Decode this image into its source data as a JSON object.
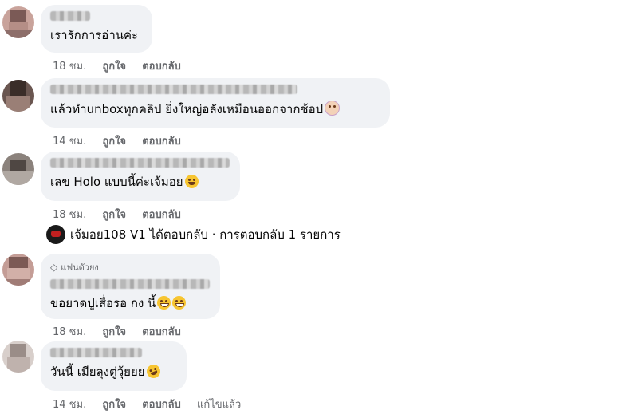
{
  "comments": [
    {
      "text": "เรารักการอ่านค่ะ",
      "time": "18 ชม.",
      "like": "ถูกใจ",
      "reply": "ตอบกลับ",
      "emoji": []
    },
    {
      "text": "แล้วทำunboxทุกคลิป ยิ่งใหญ่อลังเหมือนออกจากช้อป",
      "time": "14 ชม.",
      "like": "ถูกใจ",
      "reply": "ตอบกลับ",
      "emoji": [
        "woman-face-emoji"
      ]
    },
    {
      "text": "เลข Holo แบบนี้ค่ะเจ้มอย",
      "time": "18 ชม.",
      "like": "ถูกใจ",
      "reply": "ตอบกลับ",
      "emoji": [
        "smiling-face-emoji"
      ]
    },
    {
      "badge": "แฟนตัวยง",
      "text": "ขอยาดปูเสื่อรอ กง นี้",
      "time": "18 ชม.",
      "like": "ถูกใจ",
      "reply": "ตอบกลับ",
      "emoji": [
        "grinning-face-emoji",
        "grinning-face-emoji"
      ]
    },
    {
      "text": "วันนี้ เมียลุงตู่วุ้ยยย",
      "time": "14 ชม.",
      "like": "ถูกใจ",
      "reply": "ตอบกลับ",
      "edited": "แก้ไขแล้ว",
      "emoji": [
        "laughing-face-emoji"
      ]
    }
  ],
  "reply_summary": "เจ้มอย108 V1 ได้ตอบกลับ · การตอบกลับ 1 รายการ"
}
